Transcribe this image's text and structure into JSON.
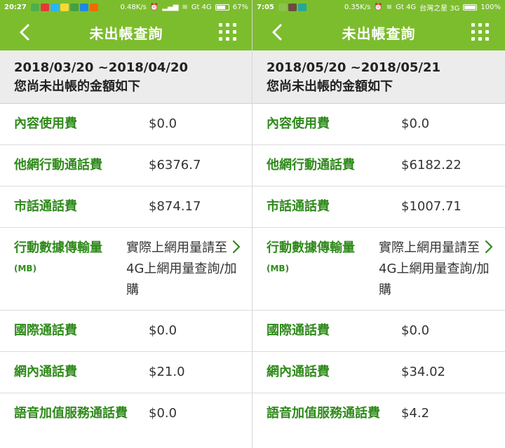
{
  "left": {
    "status": {
      "time": "20:27",
      "speed": "0.48K/s",
      "network": "Gt 4G",
      "battery": "67%",
      "battery_level": 0.67
    },
    "appbar": {
      "title": "未出帳查詢"
    },
    "period": {
      "dates": "2018/03/20 ~2018/04/20",
      "subtitle": "您尚未出帳的金額如下"
    },
    "rows": [
      {
        "label": "內容使用費",
        "value": "$0.0"
      },
      {
        "label": "他網行動通話費",
        "value": "$6376.7"
      },
      {
        "label": "市話通話費",
        "value": "$874.17"
      },
      {
        "label": "行動數據傳輸量",
        "unit": "(MB)",
        "value": "實際上網用量請至4G上網用量查詢/加購"
      },
      {
        "label": "國際通話費",
        "value": "$0.0"
      },
      {
        "label": "網內通話費",
        "value": "$21.0"
      },
      {
        "label": "語音加值服務通話費",
        "value": "$0.0"
      }
    ]
  },
  "right": {
    "status": {
      "time": "7:05",
      "speed": "0.35K/s",
      "network": "Gt 4G",
      "carrier": "台灣之星 3G",
      "battery": "100%",
      "battery_level": 1.0
    },
    "appbar": {
      "title": "未出帳查詢"
    },
    "period": {
      "dates": "2018/05/20 ~2018/05/21",
      "subtitle": "您尚未出帳的金額如下"
    },
    "rows": [
      {
        "label": "內容使用費",
        "value": "$0.0"
      },
      {
        "label": "他網行動通話費",
        "value": "$6182.22"
      },
      {
        "label": "市話通話費",
        "value": "$1007.71"
      },
      {
        "label": "行動數據傳輸量",
        "unit": "(MB)",
        "value": "實際上網用量請至4G上網用量查詢/加購"
      },
      {
        "label": "國際通話費",
        "value": "$0.0"
      },
      {
        "label": "網內通話費",
        "value": "$34.02"
      },
      {
        "label": "語音加值服務通話費",
        "value": "$4.2"
      }
    ]
  },
  "colors": {
    "brand_green": "#7cbd2e",
    "label_green": "#2f8a1b",
    "header_gray": "#ececec"
  },
  "icons": {
    "back": "chevron-left-icon",
    "menu": "grid-menu-icon",
    "row_more": "chevron-right-icon"
  }
}
